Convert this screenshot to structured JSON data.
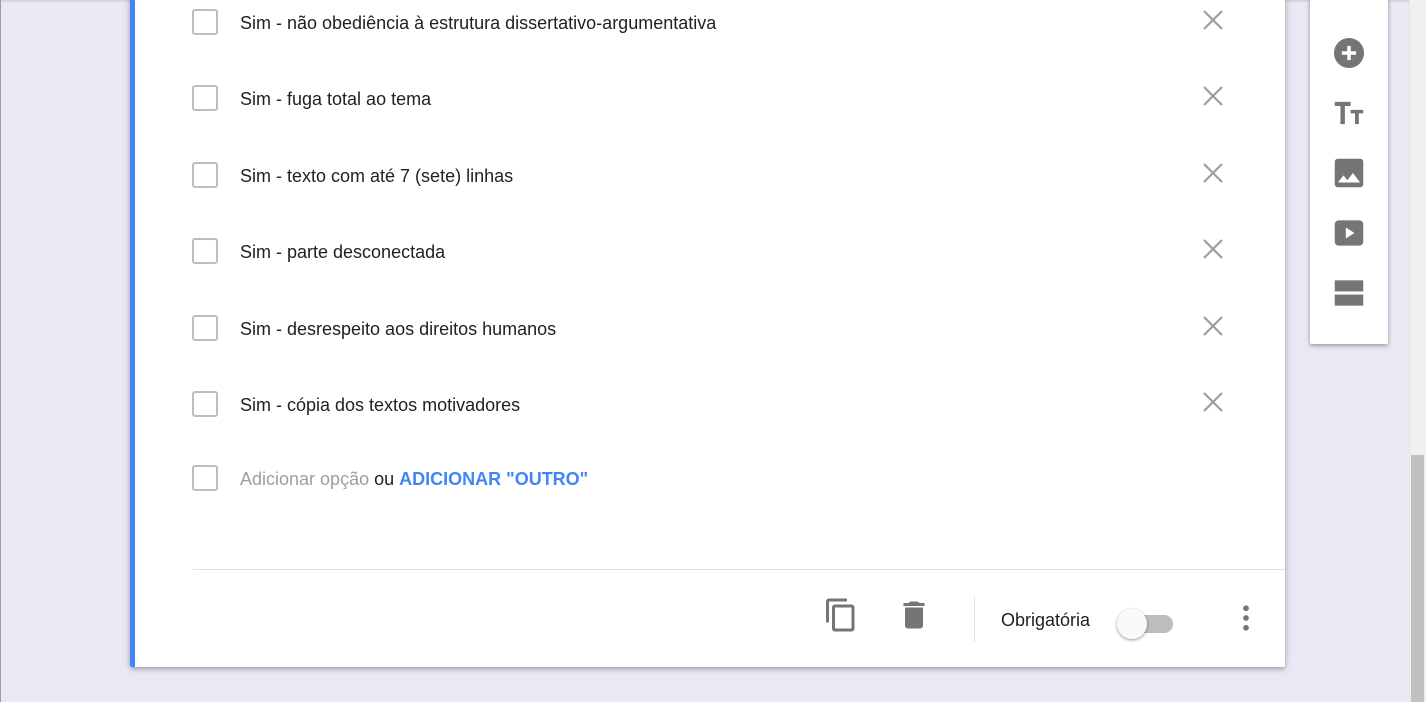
{
  "options": [
    {
      "label": "Sim - não obediência à estrutura dissertativo-argumentativa"
    },
    {
      "label": "Sim - fuga total ao tema"
    },
    {
      "label": "Sim - texto com até 7 (sete) linhas"
    },
    {
      "label": "Sim - parte desconectada"
    },
    {
      "label": "Sim - desrespeito aos direitos humanos"
    },
    {
      "label": "Sim - cópia dos textos motivadores"
    }
  ],
  "add_option": {
    "placeholder": "Adicionar opção",
    "or_text": "ou",
    "add_other_label": "ADICIONAR \"OUTRO\""
  },
  "footer": {
    "required_label": "Obrigatória",
    "required_on": false
  },
  "colors": {
    "accent": "#4285f4",
    "icon": "#757575",
    "background": "#ebe7f5"
  },
  "side_toolbar": {
    "tools": [
      "add-question-icon",
      "title-text-icon",
      "image-icon",
      "video-icon",
      "section-icon"
    ]
  }
}
